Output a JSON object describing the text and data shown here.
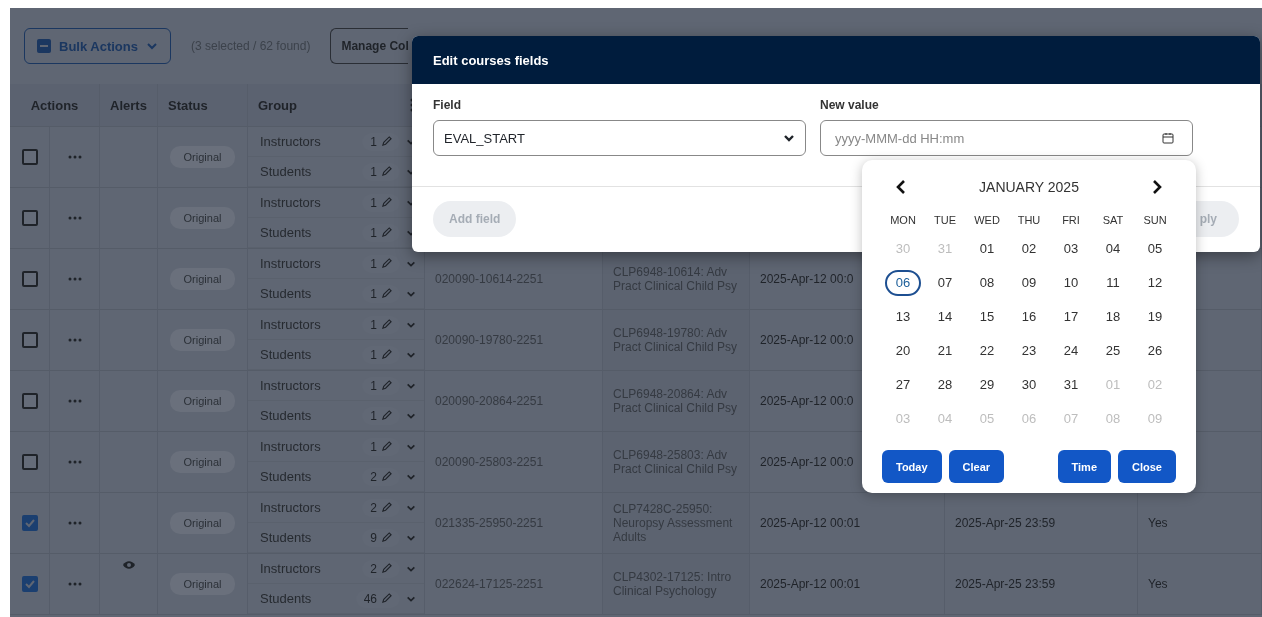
{
  "toolbar": {
    "bulk_actions": "Bulk Actions",
    "summary": "(3 selected / 62 found)",
    "buttons": [
      "Manage Col"
    ]
  },
  "table": {
    "columns": [
      "Actions",
      "Alerts",
      "Status",
      "Group"
    ],
    "rows": [
      {
        "checked": false,
        "alert": false,
        "status": "Original",
        "groups": [
          {
            "label": "Instructors",
            "count": "1"
          },
          {
            "label": "Students",
            "count": "1"
          }
        ]
      },
      {
        "checked": false,
        "alert": false,
        "status": "Original",
        "groups": [
          {
            "label": "Instructors",
            "count": "1"
          },
          {
            "label": "Students",
            "count": "1"
          }
        ]
      },
      {
        "checked": false,
        "alert": false,
        "status": "Original",
        "groups": [
          {
            "label": "Instructors",
            "count": "1"
          },
          {
            "label": "Students",
            "count": "1"
          }
        ],
        "code": "020090-10614-2251",
        "course": "CLP6948-10614: Adv Pract Clinical Child Psy",
        "start": "2025-Apr-12 00:0"
      },
      {
        "checked": false,
        "alert": false,
        "status": "Original",
        "groups": [
          {
            "label": "Instructors",
            "count": "1"
          },
          {
            "label": "Students",
            "count": "1"
          }
        ],
        "code": "020090-19780-2251",
        "course": "CLP6948-19780: Adv Pract Clinical Child Psy",
        "start": "2025-Apr-12 00:0"
      },
      {
        "checked": false,
        "alert": false,
        "status": "Original",
        "groups": [
          {
            "label": "Instructors",
            "count": "1"
          },
          {
            "label": "Students",
            "count": "1"
          }
        ],
        "code": "020090-20864-2251",
        "course": "CLP6948-20864: Adv Pract Clinical Child Psy",
        "start": "2025-Apr-12 00:0"
      },
      {
        "checked": false,
        "alert": false,
        "status": "Original",
        "groups": [
          {
            "label": "Instructors",
            "count": "1"
          },
          {
            "label": "Students",
            "count": "2"
          }
        ],
        "code": "020090-25803-2251",
        "course": "CLP6948-25803: Adv Pract Clinical Child Psy",
        "start": "2025-Apr-12 00:0"
      },
      {
        "checked": true,
        "alert": false,
        "status": "Original",
        "groups": [
          {
            "label": "Instructors",
            "count": "2"
          },
          {
            "label": "Students",
            "count": "9"
          }
        ],
        "code": "021335-25950-2251",
        "course": "CLP7428C-25950: Neuropsy Assessment Adults",
        "start": "2025-Apr-12 00:01",
        "end": "2025-Apr-25 23:59",
        "flag": "Yes"
      },
      {
        "checked": true,
        "alert": true,
        "status": "Original",
        "groups": [
          {
            "label": "Instructors",
            "count": "2"
          },
          {
            "label": "Students",
            "count": "46"
          }
        ],
        "code": "022624-17125-2251",
        "course": "CLP4302-17125: Intro Clinical Psychology",
        "start": "2025-Apr-12 00:01",
        "end": "2025-Apr-25 23:59",
        "flag": "Yes"
      }
    ]
  },
  "modal": {
    "title": "Edit courses fields",
    "field_label": "Field",
    "field_value": "EVAL_START",
    "new_value_label": "New value",
    "new_value_placeholder": "yyyy-MMM-dd HH:mm",
    "add_button": {
      "label": "Add field",
      "disabled": true
    },
    "apply_button": {
      "label": "ply",
      "disabled": true
    }
  },
  "calendar": {
    "month": "JANUARY 2025",
    "weekdays": [
      "MON",
      "TUE",
      "WED",
      "THU",
      "FRI",
      "SAT",
      "SUN"
    ],
    "days": [
      {
        "label": "30",
        "muted": true,
        "selected": false
      },
      {
        "label": "31",
        "muted": true,
        "selected": false
      },
      {
        "label": "01",
        "muted": false,
        "selected": false
      },
      {
        "label": "02",
        "muted": false,
        "selected": false
      },
      {
        "label": "03",
        "muted": false,
        "selected": false
      },
      {
        "label": "04",
        "muted": false,
        "selected": false
      },
      {
        "label": "05",
        "muted": false,
        "selected": false
      },
      {
        "label": "06",
        "muted": false,
        "selected": true
      },
      {
        "label": "07",
        "muted": false,
        "selected": false
      },
      {
        "label": "08",
        "muted": false,
        "selected": false
      },
      {
        "label": "09",
        "muted": false,
        "selected": false
      },
      {
        "label": "10",
        "muted": false,
        "selected": false
      },
      {
        "label": "11",
        "muted": false,
        "selected": false
      },
      {
        "label": "12",
        "muted": false,
        "selected": false
      },
      {
        "label": "13",
        "muted": false,
        "selected": false
      },
      {
        "label": "14",
        "muted": false,
        "selected": false
      },
      {
        "label": "15",
        "muted": false,
        "selected": false
      },
      {
        "label": "16",
        "muted": false,
        "selected": false
      },
      {
        "label": "17",
        "muted": false,
        "selected": false
      },
      {
        "label": "18",
        "muted": false,
        "selected": false
      },
      {
        "label": "19",
        "muted": false,
        "selected": false
      },
      {
        "label": "20",
        "muted": false,
        "selected": false
      },
      {
        "label": "21",
        "muted": false,
        "selected": false
      },
      {
        "label": "22",
        "muted": false,
        "selected": false
      },
      {
        "label": "23",
        "muted": false,
        "selected": false
      },
      {
        "label": "24",
        "muted": false,
        "selected": false
      },
      {
        "label": "25",
        "muted": false,
        "selected": false
      },
      {
        "label": "26",
        "muted": false,
        "selected": false
      },
      {
        "label": "27",
        "muted": false,
        "selected": false
      },
      {
        "label": "28",
        "muted": false,
        "selected": false
      },
      {
        "label": "29",
        "muted": false,
        "selected": false
      },
      {
        "label": "30",
        "muted": false,
        "selected": false
      },
      {
        "label": "31",
        "muted": false,
        "selected": false
      },
      {
        "label": "01",
        "muted": true,
        "selected": false
      },
      {
        "label": "02",
        "muted": true,
        "selected": false
      },
      {
        "label": "03",
        "muted": true,
        "selected": false
      },
      {
        "label": "04",
        "muted": true,
        "selected": false
      },
      {
        "label": "05",
        "muted": true,
        "selected": false
      },
      {
        "label": "06",
        "muted": true,
        "selected": false
      },
      {
        "label": "07",
        "muted": true,
        "selected": false
      },
      {
        "label": "08",
        "muted": true,
        "selected": false
      },
      {
        "label": "09",
        "muted": true,
        "selected": false
      }
    ],
    "buttons_left": [
      "Today",
      "Clear"
    ],
    "buttons_right": [
      "Time",
      "Close"
    ]
  }
}
